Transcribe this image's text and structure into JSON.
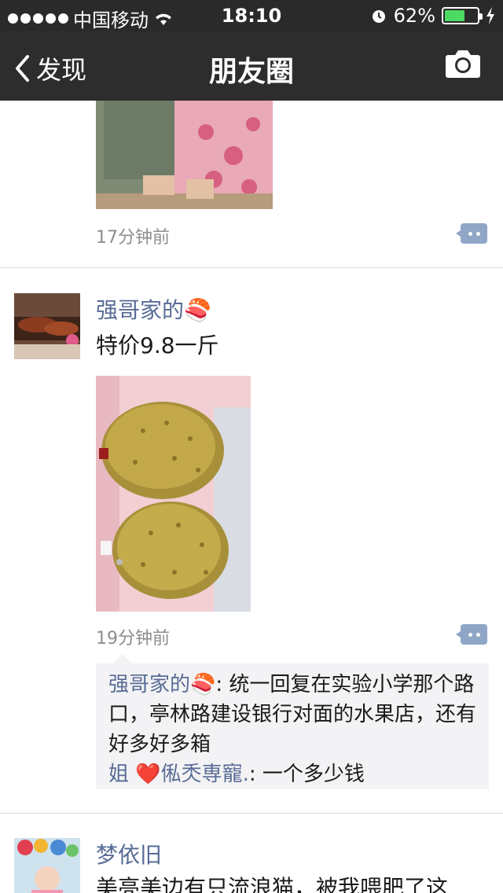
{
  "status_bar": {
    "carrier": "中国移动",
    "time": "18:10",
    "battery_percent": "62%",
    "battery_level": 0.62,
    "battery_color": "#4cd964"
  },
  "nav": {
    "back_label": "发现",
    "title": "朋友圈",
    "camera_icon": "camera-icon"
  },
  "posts": [
    {
      "time": "17分钟前"
    },
    {
      "author": "强哥家的🍣",
      "text": "特价9.8一斤",
      "time": "19分钟前",
      "comments": [
        {
          "author": "强哥家的🍣",
          "text": ": 统一回复在实验小学那个路口，亭林路建设银行对面的水果店，还有好多好多箱"
        },
        {
          "author_prefix": "姐 ",
          "heart": "❤️",
          "author": "俬秂専寵.",
          "text": ": 一个多少钱"
        }
      ]
    },
    {
      "author": "梦依旧",
      "text": "美亮美边有只流浪猫，被我喂肥了这"
    }
  ],
  "colors": {
    "nav_bg": "#2e2d2d",
    "link_blue": "#576b95",
    "comment_bg": "#f3f3f5"
  }
}
